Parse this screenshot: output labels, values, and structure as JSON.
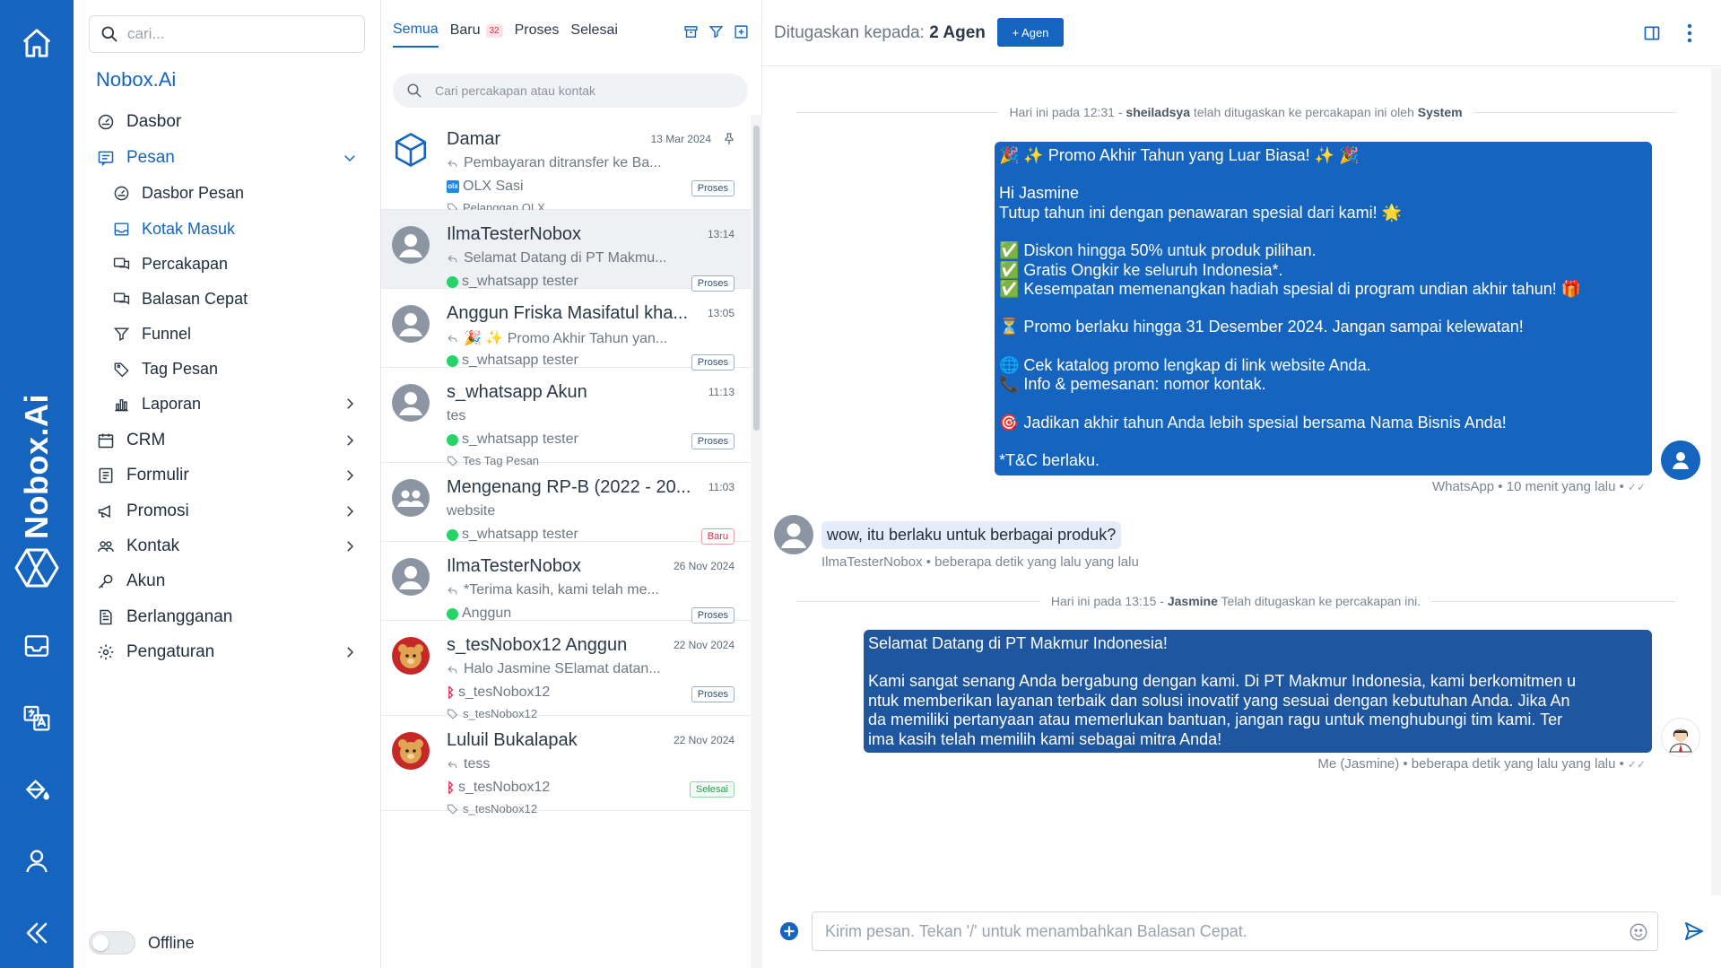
{
  "app": {
    "brand": "Nobox.Ai",
    "vertical_brand": "Nobox.Ai",
    "accent": "#1565c0"
  },
  "rail": {
    "items": [
      {
        "name": "home-icon"
      },
      {
        "name": "inbox-icon"
      },
      {
        "name": "translate-icon"
      },
      {
        "name": "paint-bucket-icon"
      },
      {
        "name": "user-icon"
      },
      {
        "name": "collapse-icon"
      }
    ]
  },
  "menu": {
    "search_placeholder": "cari...",
    "brand": "Nobox.Ai",
    "items": [
      {
        "label": "Dasbor",
        "icon": "gauge-icon"
      },
      {
        "label": "Pesan",
        "icon": "message-icon",
        "expanded": true
      },
      {
        "label": "Dasbor Pesan",
        "icon": "gauge-icon"
      },
      {
        "label": "Kotak Masuk",
        "icon": "inbox-icon",
        "active": true
      },
      {
        "label": "Percakapan",
        "icon": "chat-icon"
      },
      {
        "label": "Balasan Cepat",
        "icon": "quick-reply-icon"
      },
      {
        "label": "Funnel",
        "icon": "funnel-icon"
      },
      {
        "label": "Tag Pesan",
        "icon": "tag-icon"
      },
      {
        "label": "Laporan",
        "icon": "chart-icon"
      },
      {
        "label": "CRM",
        "icon": "calendar-icon"
      },
      {
        "label": "Formulir",
        "icon": "form-icon"
      },
      {
        "label": "Promosi",
        "icon": "megaphone-icon"
      },
      {
        "label": "Kontak",
        "icon": "contacts-icon"
      },
      {
        "label": "Akun",
        "icon": "key-icon"
      },
      {
        "label": "Berlangganan",
        "icon": "document-icon"
      },
      {
        "label": "Pengaturan",
        "icon": "gear-icon"
      }
    ],
    "status_label": "Offline"
  },
  "list": {
    "tabs": [
      {
        "label": "Semua",
        "active": true
      },
      {
        "label": "Baru",
        "count": "32"
      },
      {
        "label": "Proses"
      },
      {
        "label": "Selesai"
      }
    ],
    "search_placeholder": "Cari percakapan atau kontak",
    "conversations": [
      {
        "name": "Damar",
        "time": "13 Mar 2024",
        "preview": "Pembayaran ditransfer ke Ba...",
        "channel": "OLX Sasi",
        "tag": "Pelanggan OLX",
        "status": "Proses",
        "pinned": true
      },
      {
        "name": "IlmaTesterNobox",
        "time": "13:14",
        "preview": "Selamat Datang di PT Makmu...",
        "channel": "s_whatsapp tester",
        "tag": "",
        "status": "Proses",
        "selected": true
      },
      {
        "name": "Anggun Friska Masifatul kha...",
        "time": "13:05",
        "preview": "🎉 ✨ Promo Akhir Tahun yan...",
        "channel": "s_whatsapp tester",
        "tag": "",
        "status": "Proses"
      },
      {
        "name": "s_whatsapp Akun",
        "time": "11:13",
        "preview": "tes",
        "channel": "s_whatsapp tester",
        "tag": "Tes Tag Pesan",
        "status": "Proses"
      },
      {
        "name": "Mengenang RP-B (2022 - 20...",
        "time": "11:03",
        "preview": "website",
        "channel": "s_whatsapp tester",
        "tag": "",
        "status": "Baru"
      },
      {
        "name": "IlmaTesterNobox",
        "time": "26 Nov 2024",
        "preview": "*Terima kasih, kami telah me...",
        "channel": "Anggun",
        "tag": "",
        "status": "Proses"
      },
      {
        "name": "s_tesNobox12 Anggun",
        "time": "22 Nov 2024",
        "preview": "Halo Jasmine SElamat datan...",
        "channel": "s_tesNobox12",
        "tag": "s_tesNobox12",
        "status": "Proses"
      },
      {
        "name": "Luluil Bukalapak",
        "time": "22 Nov 2024",
        "preview": "tess",
        "channel": "s_tesNobox12",
        "tag": "s_tesNobox12",
        "status": "Selesai"
      }
    ]
  },
  "chat": {
    "assign_prefix": "Ditugaskan kepada:",
    "assign_value": "2 Agen",
    "add_agent_label": "+ Agen",
    "system1": {
      "pre": "Hari ini pada 12:31 - ",
      "user": "sheiladsya",
      "mid": " telah ditugaskan ke percakapan ini oleh ",
      "by": "System"
    },
    "promo": {
      "l1": "🎉 ✨ Promo Akhir Tahun yang Luar Biasa! ✨ 🎉",
      "l2": "Hi Jasmine",
      "l3": "Tutup tahun ini dengan penawaran spesial dari kami! 🌟",
      "l4": "✅ Diskon hingga 50% untuk produk pilihan.",
      "l5": "✅ Gratis Ongkir ke seluruh Indonesia*.",
      "l6": "✅ Kesempatan memenangkan hadiah spesial di program undian akhir tahun! 🎁",
      "l7": "⏳ Promo berlaku hingga 31 Desember 2024. Jangan sampai kelewatan!",
      "l8": "🌐 Cek katalog promo lengkap di link website Anda.",
      "l9": "📞 Info & pemesanan: nomor kontak.",
      "l10": "🎯 Jadikan akhir tahun Anda lebih spesial bersama Nama Bisnis Anda!",
      "l11": "*T&C berlaku."
    },
    "promo_meta": "WhatsApp • 10 menit yang lalu •",
    "incoming_text": "wow, itu berlaku untuk berbagai produk?",
    "incoming_meta": "IlmaTesterNobox • beberapa detik yang lalu yang lalu",
    "system2": {
      "pre": "Hari ini pada 13:15 - ",
      "user": "Jasmine",
      "post": " Telah ditugaskan ke percakapan ini."
    },
    "welcome": {
      "l1": "Selamat Datang di PT Makmur Indonesia!",
      "l2": "Kami sangat senang Anda bergabung dengan kami. Di PT Makmur Indonesia, kami berkomitmen u",
      "l3": "ntuk memberikan layanan terbaik dan solusi inovatif yang sesuai dengan kebutuhan Anda. Jika An",
      "l4": "da memiliki pertanyaan atau memerlukan bantuan, jangan ragu untuk menghubungi tim kami. Ter",
      "l5": "ima kasih telah memilih kami sebagai mitra Anda!"
    },
    "welcome_meta": "Me (Jasmine) • beberapa detik yang lalu yang lalu •",
    "composer_placeholder": "Kirim pesan. Tekan '/' untuk menambahkan Balasan Cepat."
  }
}
